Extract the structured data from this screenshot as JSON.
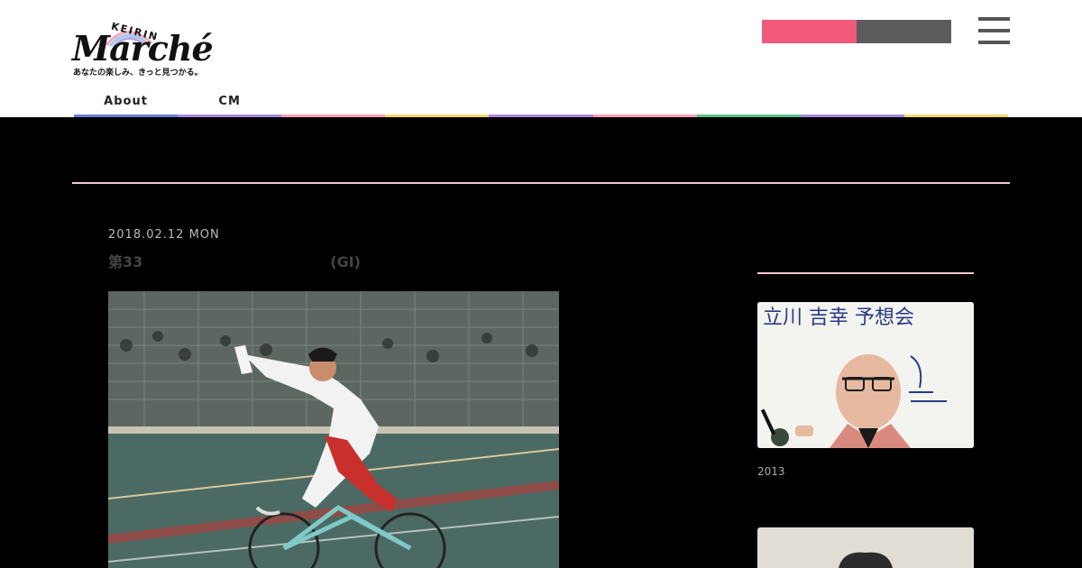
{
  "header": {
    "logo": {
      "keirin": "KEIRIN",
      "marche": "Marché",
      "tagline": "あなたの楽しみ、きっと見つかる。"
    },
    "btn_primary": "",
    "btn_secondary": "",
    "menu_icon": "hamburger-menu-icon"
  },
  "nav": [
    {
      "label": "About",
      "color": "#6b7fd7"
    },
    {
      "label": "CM",
      "color": "#a68ad9"
    },
    {
      "label": "",
      "color": "#f2a0b0"
    },
    {
      "label": "",
      "color": "#f5d76e"
    },
    {
      "label": "",
      "color": "#a68ad9"
    },
    {
      "label": "",
      "color": "#f2a0b0"
    },
    {
      "label": "",
      "color": "#5cc08a"
    },
    {
      "label": "",
      "color": "#a68ad9"
    },
    {
      "label": "",
      "color": "#f5d76e"
    }
  ],
  "section": {
    "title": ""
  },
  "post": {
    "date": "2018.02.12 MON",
    "title": "第33　　　　　　　　　　　　　(GI)"
  },
  "sidebar": {
    "item1_text": "2013",
    "item1_photo_caption": "立川 吉幸 予想会"
  },
  "colors": {
    "accent_pink": "#f25a7c",
    "button_gray": "#5c5c5c",
    "rule_pink": "#f4c6cf",
    "background": "#000000"
  }
}
